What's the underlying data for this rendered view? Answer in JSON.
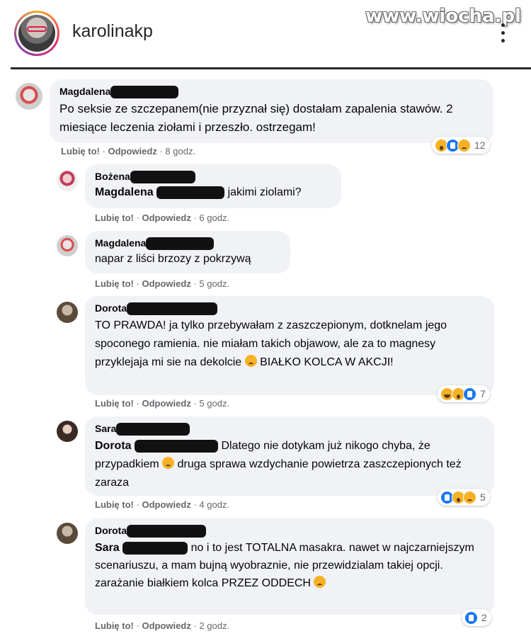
{
  "header": {
    "username": "karolinakp",
    "watermark": "www.wiocha.pl"
  },
  "comments": [
    {
      "author": "Magdalena",
      "text": "Po seksie ze szczepanem(nie przyznał się) dostałam zapalenia stawów. 2 miesiące leczenia ziołami i przeszło. ostrzegam!",
      "like": "Lubię to!",
      "reply": "Odpowiedz",
      "time": "8 godz.",
      "reactions": [
        "wow",
        "like",
        "sad"
      ],
      "reaction_count": "12"
    },
    {
      "author": "Bożena",
      "mention": "Magdalena",
      "text": "jakimi ziolami?",
      "like": "Lubię to!",
      "reply": "Odpowiedz",
      "time": "6 godz."
    },
    {
      "author": "Magdalena",
      "text": "napar z liści brzozy z pokrzywą",
      "like": "Lubię to!",
      "reply": "Odpowiedz",
      "time": "5 godz."
    },
    {
      "author": "Dorota",
      "text_1": "TO PRAWDA! ja tylko przebywałam z zaszczepionym, dotknelam jego spoconego ramienia. nie miałam takich objawow, ale za to magnesy przyklejaja mi sie na dekolcie",
      "text_2": "BIAŁKO KOLCA W AKCJI!",
      "like": "Lubię to!",
      "reply": "Odpowiedz",
      "time": "5 godz.",
      "reactions": [
        "haha",
        "wow",
        "like"
      ],
      "reaction_count": "7"
    },
    {
      "author": "Sara",
      "mention": "Dorota",
      "text_1": "Dlatego nie dotykam już nikogo chyba, że przypadkiem",
      "text_2": "druga sprawa wzdychanie powietrza zaszczepionych też zaraza",
      "like": "Lubię to!",
      "reply": "Odpowiedz",
      "time": "4 godz.",
      "reactions": [
        "like",
        "wow",
        "sad"
      ],
      "reaction_count": "5"
    },
    {
      "author": "Dorota",
      "mention": "Sara",
      "text": "no i to jest TOTALNA masakra. nawet w najczarniejszym scenariuszu, a mam bujną wyobraznie, nie przewidzialam takiej opcji. zarażanie białkiem kolca PRZEZ ODDECH",
      "like": "Lubię to!",
      "reply": "Odpowiedz",
      "time": "2 godz.",
      "reactions": [
        "like"
      ],
      "reaction_count": "2"
    }
  ],
  "separator": "·"
}
